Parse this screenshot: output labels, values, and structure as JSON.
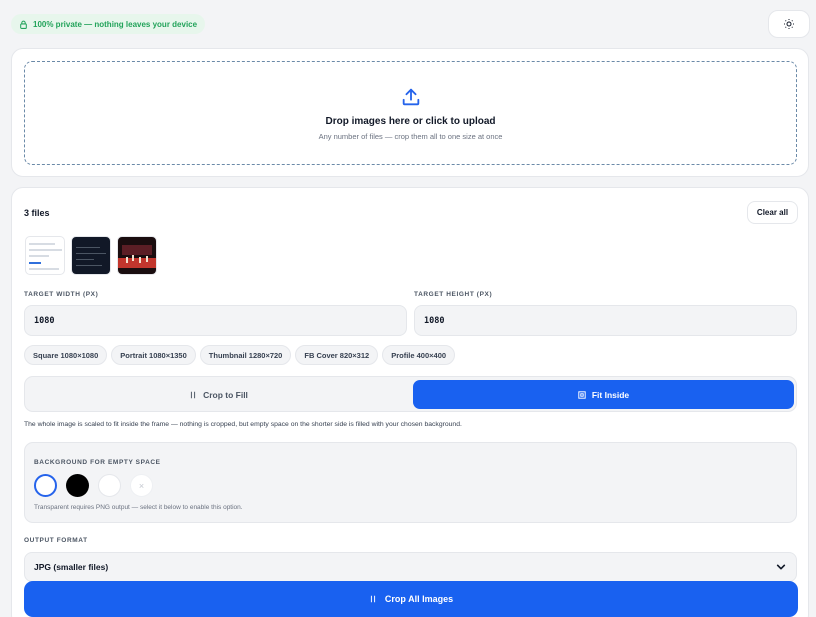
{
  "header": {
    "privacy_badge": "100% private — nothing leaves your device",
    "privacy_icon": "lock-icon",
    "theme_icon": "sun-icon"
  },
  "upload": {
    "title": "Drop images here or click to upload",
    "subtitle": "Any number of files — crop them all to one size at once",
    "icon": "upload-icon"
  },
  "files": {
    "count_label": "3 files",
    "clear_label": "Clear all"
  },
  "dimensions": {
    "width_label": "TARGET WIDTH (PX)",
    "width_value": "1080",
    "height_label": "TARGET HEIGHT (PX)",
    "height_value": "1080"
  },
  "presets": [
    {
      "label": "Square 1080×1080"
    },
    {
      "label": "Portrait 1080×1350"
    },
    {
      "label": "Thumbnail 1280×720"
    },
    {
      "label": "FB Cover 820×312"
    },
    {
      "label": "Profile 400×400"
    }
  ],
  "mode": {
    "crop_label": "Crop to Fill",
    "fit_label": "Fit Inside",
    "selected": "Fit Inside",
    "description": "The whole image is scaled to fit inside the frame — nothing is cropped, but empty space on the shorter side is filled with your chosen background."
  },
  "background": {
    "label": "BACKGROUND FOR EMPTY SPACE",
    "note": "Transparent requires PNG output — select it below to enable this option.",
    "transparent_glyph": "×"
  },
  "output": {
    "label": "OUTPUT FORMAT",
    "selected": "JPG (smaller files)"
  },
  "action": {
    "crop_all_label": "Crop All Images"
  },
  "colors": {
    "accent": "#1961f0",
    "privacy_green": "#22a35a",
    "privacy_bg": "#e7f6ec",
    "swatch_selected": "#ffffff",
    "swatch_black": "#000000",
    "swatch_white": "#ffffff"
  }
}
